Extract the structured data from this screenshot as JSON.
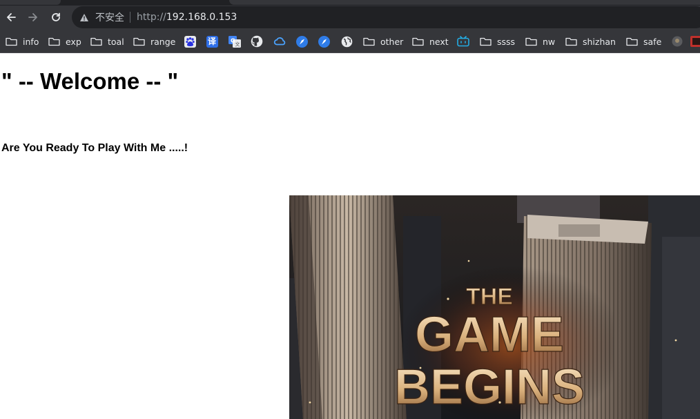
{
  "browser": {
    "address": {
      "security_text": "不安全",
      "scheme": "http://",
      "host": "192.168.0.153"
    },
    "bookmarks": [
      {
        "type": "folder",
        "label": "info"
      },
      {
        "type": "folder",
        "label": "exp"
      },
      {
        "type": "folder",
        "label": "toal"
      },
      {
        "type": "folder",
        "label": "range"
      },
      {
        "type": "icon",
        "icon": "baidu-paw-icon"
      },
      {
        "type": "icon",
        "icon": "translate-icon",
        "glyph": "译"
      },
      {
        "type": "icon",
        "icon": "google-translate-icon"
      },
      {
        "type": "icon",
        "icon": "github-icon"
      },
      {
        "type": "icon",
        "icon": "cloud-icon"
      },
      {
        "type": "icon",
        "icon": "app-icon-1"
      },
      {
        "type": "icon",
        "icon": "app-icon-2"
      },
      {
        "type": "icon",
        "icon": "globe-icon"
      },
      {
        "type": "folder",
        "label": "other"
      },
      {
        "type": "folder",
        "label": "next"
      },
      {
        "type": "icon",
        "icon": "bilibili-icon"
      },
      {
        "type": "folder",
        "label": "ssss"
      },
      {
        "type": "folder",
        "label": "nw"
      },
      {
        "type": "folder",
        "label": "shizhan"
      },
      {
        "type": "folder",
        "label": "safe"
      }
    ]
  },
  "page": {
    "heading": "\" -- Welcome -- \"",
    "subheading": "Are You Ready To Play With Me .....!",
    "banner": {
      "line1": "THE",
      "line2": "GAME",
      "line3": "BEGINS"
    }
  }
}
